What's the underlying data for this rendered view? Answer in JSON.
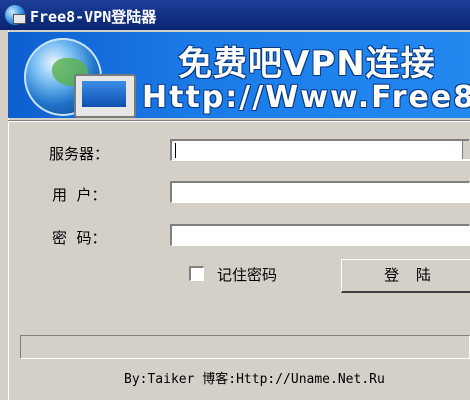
{
  "window": {
    "title": "Free8-VPN登陆器"
  },
  "banner": {
    "line1": "免费吧VPN连接",
    "line2": "Http://Www.Free8"
  },
  "form": {
    "server_label": "服务器：",
    "server_value": "",
    "user_label": "用  户：",
    "user_value": "",
    "password_label": "密  码：",
    "password_value": "",
    "remember_label": "记住密码",
    "remember_checked": false,
    "login_button": "登 陆"
  },
  "status": {
    "text": ""
  },
  "footer": {
    "credit": "By:Taiker 博客:Http://Uname.Net.Ru"
  }
}
